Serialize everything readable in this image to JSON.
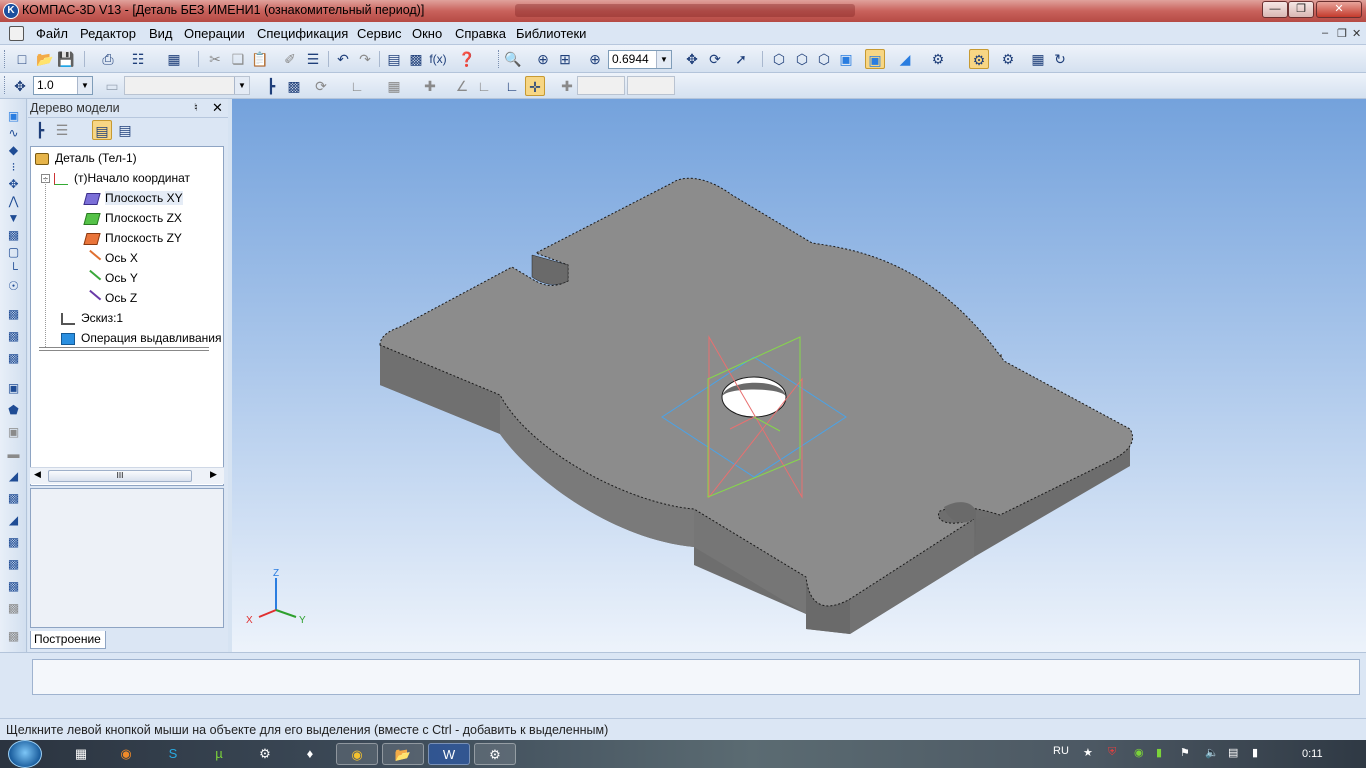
{
  "window": {
    "title": "КОМПАС-3D V13 - [Деталь БЕЗ ИМЕНИ1 (ознакомительный период)]",
    "app_icon": "K",
    "controls": [
      "minimize",
      "maximize",
      "close"
    ]
  },
  "menu": {
    "items": [
      "Файл",
      "Редактор",
      "Вид",
      "Операции",
      "Спецификация",
      "Сервис",
      "Окно",
      "Справка",
      "Библиотеки"
    ]
  },
  "toolbar": {
    "zoom_value": "0.6944",
    "step_value": "1.0"
  },
  "tree": {
    "header": "Дерево модели",
    "pin_icon": "pin-icon",
    "close_icon": "close-icon",
    "nodes": [
      {
        "label": "Деталь (Тел-1)",
        "icon": "part-icon"
      },
      {
        "label": "(т)Начало координат",
        "icon": "origin-icon"
      },
      {
        "label": "Плоскость XY",
        "icon": "plane-xy-icon"
      },
      {
        "label": "Плоскость ZX",
        "icon": "plane-zx-icon"
      },
      {
        "label": "Плоскость ZY",
        "icon": "plane-zy-icon"
      },
      {
        "label": "Ось X",
        "icon": "axis-x-icon"
      },
      {
        "label": "Ось Y",
        "icon": "axis-y-icon"
      },
      {
        "label": "Ось Z",
        "icon": "axis-z-icon"
      },
      {
        "label": "Эскиз:1",
        "icon": "sketch-icon"
      },
      {
        "label": "Операция выдавливания",
        "icon": "extrude-icon"
      }
    ],
    "scroll_grip": "III",
    "tab": "Построение"
  },
  "triad": {
    "x": "X",
    "y": "Y",
    "z": "Z"
  },
  "colors": {
    "plane_xy": "#4aa3e8",
    "plane_zx": "#e87070",
    "plane_zy": "#86d84a",
    "part": "#8a8a8a"
  },
  "status": {
    "text": "Щелкните левой кнопкой мыши на объекте для его выделения (вместе с Ctrl - добавить к выделенным)"
  },
  "taskbar": {
    "language": "RU",
    "time": "0:11"
  }
}
